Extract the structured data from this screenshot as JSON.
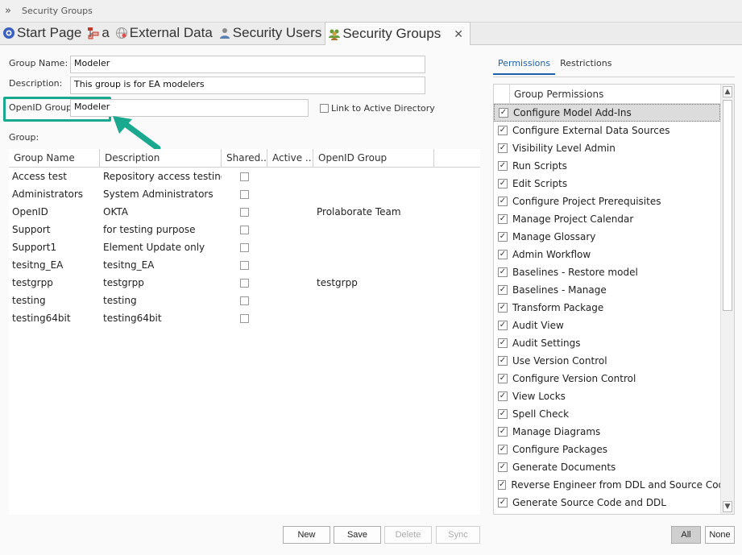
{
  "window": {
    "title": "Security Groups"
  },
  "tabs": [
    {
      "label": "Start Page",
      "icon": "start-page-icon"
    },
    {
      "label": "a",
      "icon": "diagram-icon"
    },
    {
      "label": "External Data",
      "icon": "external-data-icon"
    },
    {
      "label": "Security Users",
      "icon": "user-icon"
    },
    {
      "label": "Security Groups",
      "icon": "group-icon",
      "active": true
    }
  ],
  "form": {
    "group_name_label": "Group Name:",
    "group_name_value": "Modeler",
    "description_label": "Description:",
    "description_value": "This group is for EA modelers",
    "openid_label": "OpenID Group:",
    "openid_value": "Modeler",
    "link_ad_label": "Link to Active Directory",
    "group_label": "Group:"
  },
  "table": {
    "headers": [
      "Group Name",
      "Description",
      "Shared...",
      "Active ...",
      "OpenID Group"
    ],
    "rows": [
      {
        "name": "Access test",
        "description": "Repository access testing",
        "openid": ""
      },
      {
        "name": "Administrators",
        "description": "System Administrators",
        "openid": ""
      },
      {
        "name": "OpenID",
        "description": "OKTA",
        "openid": "Prolaborate Team"
      },
      {
        "name": "Support",
        "description": "for testing purpose",
        "openid": ""
      },
      {
        "name": "Support1",
        "description": "Element Update only",
        "openid": ""
      },
      {
        "name": "tesitng_EA",
        "description": "tesitng_EA",
        "openid": ""
      },
      {
        "name": "testgrpp",
        "description": "testgrpp",
        "openid": "testgrpp"
      },
      {
        "name": "testing",
        "description": "testing",
        "openid": ""
      },
      {
        "name": "testing64bit",
        "description": "testing64bit",
        "openid": ""
      }
    ]
  },
  "buttons": {
    "new": "New",
    "save": "Save",
    "delete": "Delete",
    "sync": "Sync",
    "all": "All",
    "none": "None"
  },
  "right_tabs": {
    "permissions": "Permissions",
    "restrictions": "Restrictions"
  },
  "permissions": {
    "header": "Group Permissions",
    "check_glyph": "✓",
    "items": [
      "Configure Model Add-Ins",
      "Configure External Data Sources",
      "Visibility Level Admin",
      "Run Scripts",
      "Edit Scripts",
      "Configure Project Prerequisites",
      "Manage Project Calendar",
      "Manage Glossary",
      "Admin Workflow",
      "Baselines - Restore model",
      "Baselines - Manage",
      "Transform Package",
      "Audit View",
      "Audit Settings",
      "Use Version Control",
      "Configure Version Control",
      "View Locks",
      "Spell Check",
      "Manage Diagrams",
      "Configure Packages",
      "Generate Documents",
      "Reverse Engineer from DDL and Source Code",
      "Generate Source Code and DDL"
    ]
  },
  "colors": {
    "callout": "#1aa88e",
    "accent": "#1d5fa8"
  }
}
